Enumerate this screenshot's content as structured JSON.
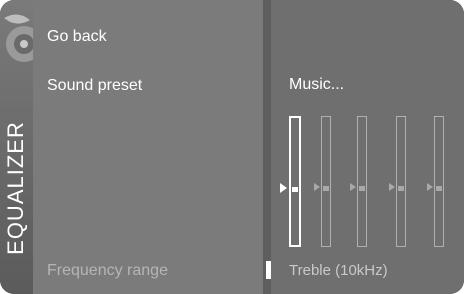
{
  "sidebar": {
    "title": "EQUALIZER"
  },
  "menu": {
    "items": [
      {
        "label": "Go back"
      },
      {
        "label": "Sound preset"
      },
      {
        "label": "Frequency range"
      }
    ]
  },
  "content": {
    "preset_value": "Music...",
    "frequency_value": "Treble (10kHz)"
  },
  "equalizer": {
    "bands": [
      {
        "level": 0.5,
        "selected": true
      },
      {
        "level": 0.5,
        "selected": false
      },
      {
        "level": 0.5,
        "selected": false
      },
      {
        "level": 0.5,
        "selected": false
      },
      {
        "level": 0.5,
        "selected": false
      }
    ]
  },
  "colors": {
    "menu_bg": "#7b7b7b",
    "content_bg": "#6f6f6f",
    "text": "#ffffff",
    "dim_text": "#b5b5b5"
  }
}
